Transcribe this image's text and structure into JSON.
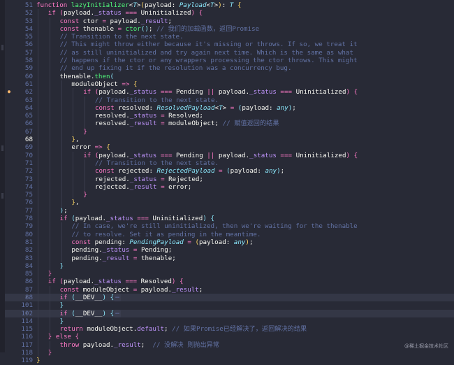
{
  "editor": {
    "colors": {
      "background": "#282a36",
      "highlight": "#343746",
      "keyword": "#ff79c6",
      "function": "#50fa7b",
      "type": "#8be9fd",
      "comment": "#6272a4",
      "property": "#bd93f9"
    },
    "lines": [
      {
        "n": "51",
        "tokens": [
          [
            "kw",
            "function "
          ],
          [
            "fn",
            "lazyInitializer"
          ],
          [
            "pn",
            "<"
          ],
          [
            "ty",
            "T"
          ],
          [
            "pn",
            ">"
          ],
          [
            "br1",
            "("
          ],
          [
            "pn",
            "payload: "
          ],
          [
            "ty",
            "Payload"
          ],
          [
            "pn",
            "<"
          ],
          [
            "ty",
            "T"
          ],
          [
            "pn",
            ">"
          ],
          [
            "br1",
            ")"
          ],
          [
            "pn",
            ": "
          ],
          [
            "ty",
            "T"
          ],
          [
            "pn",
            " "
          ],
          [
            "br1",
            "{"
          ]
        ]
      },
      {
        "n": "52",
        "indent": 1,
        "tokens": [
          [
            "kw",
            "if "
          ],
          [
            "br2",
            "("
          ],
          [
            "pn",
            "payload."
          ],
          [
            "pr",
            "_status"
          ],
          [
            "op",
            " === "
          ],
          [
            "pn",
            "Uninitialized"
          ],
          [
            "br2",
            ")"
          ],
          [
            "pn",
            " "
          ],
          [
            "br2",
            "{"
          ]
        ]
      },
      {
        "n": "53",
        "indent": 2,
        "tokens": [
          [
            "kw",
            "const "
          ],
          [
            "pn",
            "ctor "
          ],
          [
            "op",
            "= "
          ],
          [
            "pn",
            "payload."
          ],
          [
            "pr",
            "_result"
          ],
          [
            "pn",
            ";"
          ]
        ]
      },
      {
        "n": "54",
        "indent": 2,
        "tokens": [
          [
            "kw",
            "const "
          ],
          [
            "pn",
            "thenable "
          ],
          [
            "op",
            "= "
          ],
          [
            "fn",
            "ctor"
          ],
          [
            "br3",
            "()"
          ],
          [
            "pn",
            "; "
          ],
          [
            "cm",
            "// 我们的加载函数，返回Promise"
          ]
        ]
      },
      {
        "n": "55",
        "indent": 2,
        "tokens": [
          [
            "cm",
            "// Transition to the next state."
          ]
        ]
      },
      {
        "n": "56",
        "indent": 2,
        "tokens": [
          [
            "cm",
            "// This might throw either because it's missing or throws. If so, we treat it"
          ]
        ]
      },
      {
        "n": "57",
        "indent": 2,
        "tokens": [
          [
            "cm",
            "// as still uninitialized and try again next time. Which is the same as what"
          ]
        ]
      },
      {
        "n": "58",
        "indent": 2,
        "tokens": [
          [
            "cm",
            "// happens if the ctor or any wrappers processing the ctor throws. This might"
          ]
        ]
      },
      {
        "n": "59",
        "indent": 2,
        "tokens": [
          [
            "cm",
            "// end up fixing it if the resolution was a concurrency bug."
          ]
        ]
      },
      {
        "n": "60",
        "indent": 2,
        "tokens": [
          [
            "pn",
            "thenable."
          ],
          [
            "fn",
            "then"
          ],
          [
            "br3",
            "("
          ]
        ]
      },
      {
        "n": "61",
        "indent": 3,
        "tokens": [
          [
            "pn",
            "moduleObject "
          ],
          [
            "op",
            "=> "
          ],
          [
            "br1",
            "{"
          ]
        ]
      },
      {
        "n": "62",
        "indent": 4,
        "marker": true,
        "tokens": [
          [
            "kw",
            "if "
          ],
          [
            "br2",
            "("
          ],
          [
            "pn",
            "payload."
          ],
          [
            "pr",
            "_status"
          ],
          [
            "op",
            " === "
          ],
          [
            "pn",
            "Pending "
          ],
          [
            "op",
            "|| "
          ],
          [
            "pn",
            "payload."
          ],
          [
            "pr",
            "_status"
          ],
          [
            "op",
            " === "
          ],
          [
            "pn",
            "Uninitialized"
          ],
          [
            "br2",
            ")"
          ],
          [
            "pn",
            " "
          ],
          [
            "br2",
            "{"
          ]
        ]
      },
      {
        "n": "63",
        "indent": 5,
        "tokens": [
          [
            "cm",
            "// Transition to the next state."
          ]
        ]
      },
      {
        "n": "64",
        "indent": 5,
        "tokens": [
          [
            "kw",
            "const "
          ],
          [
            "pn",
            "resolved: "
          ],
          [
            "ty",
            "ResolvedPayload"
          ],
          [
            "pn",
            "<"
          ],
          [
            "ty",
            "T"
          ],
          [
            "pn",
            "> "
          ],
          [
            "op",
            "= "
          ],
          [
            "br3",
            "("
          ],
          [
            "pn",
            "payload: "
          ],
          [
            "ty",
            "any"
          ],
          [
            "br3",
            ")"
          ],
          [
            "pn",
            ";"
          ]
        ]
      },
      {
        "n": "65",
        "indent": 5,
        "tokens": [
          [
            "pn",
            "resolved."
          ],
          [
            "pr",
            "_status"
          ],
          [
            "op",
            " = "
          ],
          [
            "pn",
            "Resolved;"
          ]
        ]
      },
      {
        "n": "66",
        "indent": 5,
        "tokens": [
          [
            "pn",
            "resolved."
          ],
          [
            "pr",
            "_result"
          ],
          [
            "op",
            " = "
          ],
          [
            "pn",
            "moduleObject; "
          ],
          [
            "cm",
            "// 赋值返回的结果"
          ]
        ]
      },
      {
        "n": "67",
        "indent": 4,
        "tokens": [
          [
            "br2",
            "}"
          ]
        ]
      },
      {
        "n": "68",
        "indent": 3,
        "current": true,
        "tokens": [
          [
            "br1",
            "}"
          ],
          [
            "pn",
            ","
          ]
        ]
      },
      {
        "n": "69",
        "indent": 3,
        "tokens": [
          [
            "pn",
            "error "
          ],
          [
            "op",
            "=> "
          ],
          [
            "br1",
            "{"
          ]
        ]
      },
      {
        "n": "70",
        "indent": 4,
        "tokens": [
          [
            "kw",
            "if "
          ],
          [
            "br2",
            "("
          ],
          [
            "pn",
            "payload."
          ],
          [
            "pr",
            "_status"
          ],
          [
            "op",
            " === "
          ],
          [
            "pn",
            "Pending "
          ],
          [
            "op",
            "|| "
          ],
          [
            "pn",
            "payload."
          ],
          [
            "pr",
            "_status"
          ],
          [
            "op",
            " === "
          ],
          [
            "pn",
            "Uninitialized"
          ],
          [
            "br2",
            ")"
          ],
          [
            "pn",
            " "
          ],
          [
            "br2",
            "{"
          ]
        ]
      },
      {
        "n": "71",
        "indent": 5,
        "tokens": [
          [
            "cm",
            "// Transition to the next state."
          ]
        ]
      },
      {
        "n": "72",
        "indent": 5,
        "tokens": [
          [
            "kw",
            "const "
          ],
          [
            "pn",
            "rejected: "
          ],
          [
            "ty",
            "RejectedPayload "
          ],
          [
            "op",
            "= "
          ],
          [
            "br3",
            "("
          ],
          [
            "pn",
            "payload: "
          ],
          [
            "ty",
            "any"
          ],
          [
            "br3",
            ")"
          ],
          [
            "pn",
            ";"
          ]
        ]
      },
      {
        "n": "73",
        "indent": 5,
        "tokens": [
          [
            "pn",
            "rejected."
          ],
          [
            "pr",
            "_status"
          ],
          [
            "op",
            " = "
          ],
          [
            "pn",
            "Rejected;"
          ]
        ]
      },
      {
        "n": "74",
        "indent": 5,
        "tokens": [
          [
            "pn",
            "rejected."
          ],
          [
            "pr",
            "_result"
          ],
          [
            "op",
            " = "
          ],
          [
            "pn",
            "error;"
          ]
        ]
      },
      {
        "n": "75",
        "indent": 4,
        "tokens": [
          [
            "br2",
            "}"
          ]
        ]
      },
      {
        "n": "76",
        "indent": 3,
        "tokens": [
          [
            "br1",
            "}"
          ],
          [
            "pn",
            ","
          ]
        ]
      },
      {
        "n": "77",
        "indent": 2,
        "tokens": [
          [
            "br3",
            ")"
          ],
          [
            "pn",
            ";"
          ]
        ]
      },
      {
        "n": "78",
        "indent": 2,
        "tokens": [
          [
            "kw",
            "if "
          ],
          [
            "br3",
            "("
          ],
          [
            "pn",
            "payload."
          ],
          [
            "pr",
            "_status"
          ],
          [
            "op",
            " === "
          ],
          [
            "pn",
            "Uninitialized"
          ],
          [
            "br3",
            ")"
          ],
          [
            "pn",
            " "
          ],
          [
            "br3",
            "{"
          ]
        ]
      },
      {
        "n": "79",
        "indent": 3,
        "tokens": [
          [
            "cm",
            "// In case, we're still uninitialized, then we're waiting for the thenable"
          ]
        ]
      },
      {
        "n": "80",
        "indent": 3,
        "tokens": [
          [
            "cm",
            "// to resolve. Set it as pending in the meantime."
          ]
        ]
      },
      {
        "n": "81",
        "indent": 3,
        "tokens": [
          [
            "kw",
            "const "
          ],
          [
            "pn",
            "pending: "
          ],
          [
            "ty",
            "PendingPayload "
          ],
          [
            "op",
            "= "
          ],
          [
            "br1",
            "("
          ],
          [
            "pn",
            "payload: "
          ],
          [
            "ty",
            "any"
          ],
          [
            "br1",
            ")"
          ],
          [
            "pn",
            ";"
          ]
        ]
      },
      {
        "n": "82",
        "indent": 3,
        "tokens": [
          [
            "pn",
            "pending."
          ],
          [
            "pr",
            "_status"
          ],
          [
            "op",
            " = "
          ],
          [
            "pn",
            "Pending;"
          ]
        ]
      },
      {
        "n": "83",
        "indent": 3,
        "tokens": [
          [
            "pn",
            "pending."
          ],
          [
            "pr",
            "_result"
          ],
          [
            "op",
            " = "
          ],
          [
            "pn",
            "thenable;"
          ]
        ]
      },
      {
        "n": "84",
        "indent": 2,
        "tokens": [
          [
            "br3",
            "}"
          ]
        ]
      },
      {
        "n": "85",
        "indent": 1,
        "tokens": [
          [
            "br2",
            "}"
          ]
        ]
      },
      {
        "n": "86",
        "indent": 1,
        "tokens": [
          [
            "kw",
            "if "
          ],
          [
            "br2",
            "("
          ],
          [
            "pn",
            "payload."
          ],
          [
            "pr",
            "_status"
          ],
          [
            "op",
            " === "
          ],
          [
            "pn",
            "Resolved"
          ],
          [
            "br2",
            ")"
          ],
          [
            "pn",
            " "
          ],
          [
            "br2",
            "{"
          ]
        ]
      },
      {
        "n": "87",
        "indent": 2,
        "tokens": [
          [
            "kw",
            "const "
          ],
          [
            "pn",
            "moduleObject "
          ],
          [
            "op",
            "= "
          ],
          [
            "pn",
            "payload."
          ],
          [
            "pr",
            "_result"
          ],
          [
            "pn",
            ";"
          ]
        ]
      },
      {
        "n": "88",
        "indent": 2,
        "folded": true,
        "highlight": true,
        "tokens": [
          [
            "kw",
            "if "
          ],
          [
            "br3",
            "("
          ],
          [
            "pn",
            "__DEV__"
          ],
          [
            "br3",
            ")"
          ],
          [
            "pn",
            " "
          ],
          [
            "br3",
            "{"
          ],
          [
            "fd",
            "⋯"
          ]
        ]
      },
      {
        "n": "101",
        "indent": 2,
        "tokens": [
          [
            "br3",
            "}"
          ]
        ]
      },
      {
        "n": "102",
        "indent": 2,
        "folded": true,
        "highlight": true,
        "tokens": [
          [
            "kw",
            "if "
          ],
          [
            "br3",
            "("
          ],
          [
            "pn",
            "__DEV__"
          ],
          [
            "br3",
            ")"
          ],
          [
            "pn",
            " "
          ],
          [
            "br3",
            "{"
          ],
          [
            "fd",
            "⋯"
          ]
        ]
      },
      {
        "n": "114",
        "indent": 2,
        "tokens": [
          [
            "br3",
            "}"
          ]
        ]
      },
      {
        "n": "115",
        "indent": 2,
        "tokens": [
          [
            "kw",
            "return "
          ],
          [
            "pn",
            "moduleObject."
          ],
          [
            "pr",
            "default"
          ],
          [
            "pn",
            "; "
          ],
          [
            "cm",
            "// 如果Promise已经解决了，返回解决的结果"
          ]
        ]
      },
      {
        "n": "116",
        "indent": 1,
        "tokens": [
          [
            "br2",
            "}"
          ],
          [
            "kw",
            " else "
          ],
          [
            "br2",
            "{"
          ]
        ]
      },
      {
        "n": "117",
        "indent": 2,
        "tokens": [
          [
            "kw",
            "throw "
          ],
          [
            "pn",
            "payload."
          ],
          [
            "pr",
            "_result"
          ],
          [
            "pn",
            ";  "
          ],
          [
            "cm",
            "// 没解决 则抛出异常"
          ]
        ]
      },
      {
        "n": "118",
        "indent": 1,
        "tokens": [
          [
            "br2",
            "}"
          ]
        ]
      },
      {
        "n": "119",
        "indent": 0,
        "tokens": [
          [
            "br1",
            "}"
          ]
        ]
      }
    ]
  },
  "watermark": "@稀土掘金技术社区"
}
